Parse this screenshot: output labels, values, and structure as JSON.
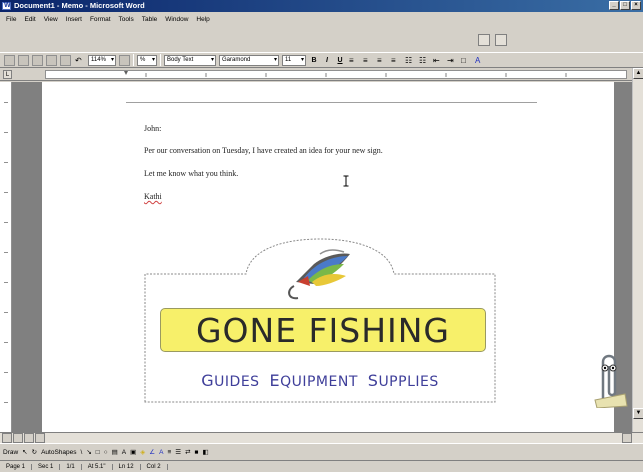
{
  "window": {
    "title": "Document1 - Memo - Microsoft Word"
  },
  "menu": [
    "File",
    "Edit",
    "View",
    "Insert",
    "Format",
    "Tools",
    "Table",
    "Window",
    "Help"
  ],
  "toolbar": {
    "zoom": "114%",
    "percent": "%",
    "style": "Body Text",
    "font": "Garamond",
    "size": "11",
    "bold": "B",
    "italic": "I",
    "underline": "U"
  },
  "ruler": {
    "tab_selector": "L"
  },
  "document": {
    "line1": "John:",
    "line2": "Per our conversation on Tuesday, I have created an idea for your new sign.",
    "line3": "Let me know what you think.",
    "line4": "Kathi"
  },
  "sign": {
    "banner": "GONE FISHING",
    "tagline": [
      {
        "cap": "G",
        "rest": "UIDES"
      },
      {
        "cap": "E",
        "rest": "QUIPMENT"
      },
      {
        "cap": "S",
        "rest": "UPPLIES"
      }
    ]
  },
  "drawbar": {
    "draw": "Draw",
    "autoshapes": "AutoShapes"
  },
  "status": {
    "page": "Page 1",
    "sec": "Sec 1",
    "pages": "1/1",
    "at": "At 5.1\"",
    "ln": "Ln 12",
    "col": "Col 2"
  }
}
